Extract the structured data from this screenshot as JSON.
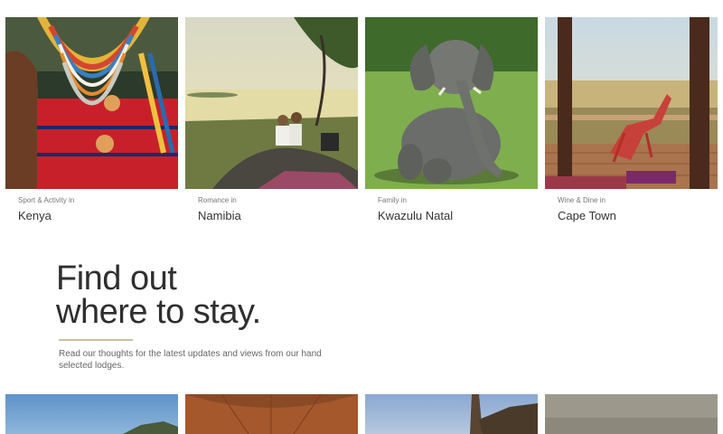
{
  "destinations": [
    {
      "category": "Sport & Activity in",
      "place": "Kenya"
    },
    {
      "category": "Romance in",
      "place": "Namibia"
    },
    {
      "category": "Family in",
      "place": "Kwazulu Natal"
    },
    {
      "category": "Wine & Dine in",
      "place": "Cape Town"
    }
  ],
  "feature": {
    "title_line1": "Find out",
    "title_line2": "where to stay.",
    "description": "Read our thoughts for the latest updates and views from our hand selected lodges."
  },
  "colors": {
    "accent_rule": "#cbbf9f",
    "title_text": "#2f2f2f",
    "body_text": "#666666"
  }
}
